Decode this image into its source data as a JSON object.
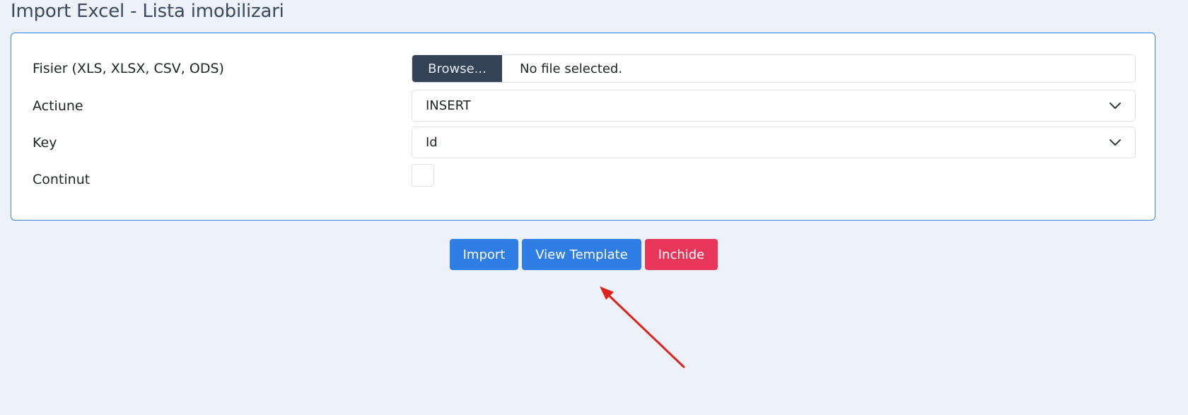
{
  "page": {
    "title": "Import Excel - Lista imobilizari"
  },
  "form": {
    "file_field": {
      "label": "Fisier (XLS, XLSX, CSV, ODS)",
      "browse_label": "Browse...",
      "status": "No file selected."
    },
    "action_field": {
      "label": "Actiune",
      "selected": "INSERT"
    },
    "key_field": {
      "label": "Key",
      "selected": "Id"
    },
    "content_field": {
      "label": "Continut",
      "checked": false
    }
  },
  "buttons": {
    "import_label": "Import",
    "view_template_label": "View Template",
    "close_label": "Inchide"
  },
  "colors": {
    "page_background": "#edf1f9",
    "card_border": "#3d84e0",
    "primary": "#2f7ee6",
    "danger": "#e8365a",
    "browse_background": "#344256",
    "annotation_arrow": "#e0221b"
  },
  "icons": {
    "select_indicator": "chevron-down-icon",
    "annotation": "arrow-annotation"
  }
}
